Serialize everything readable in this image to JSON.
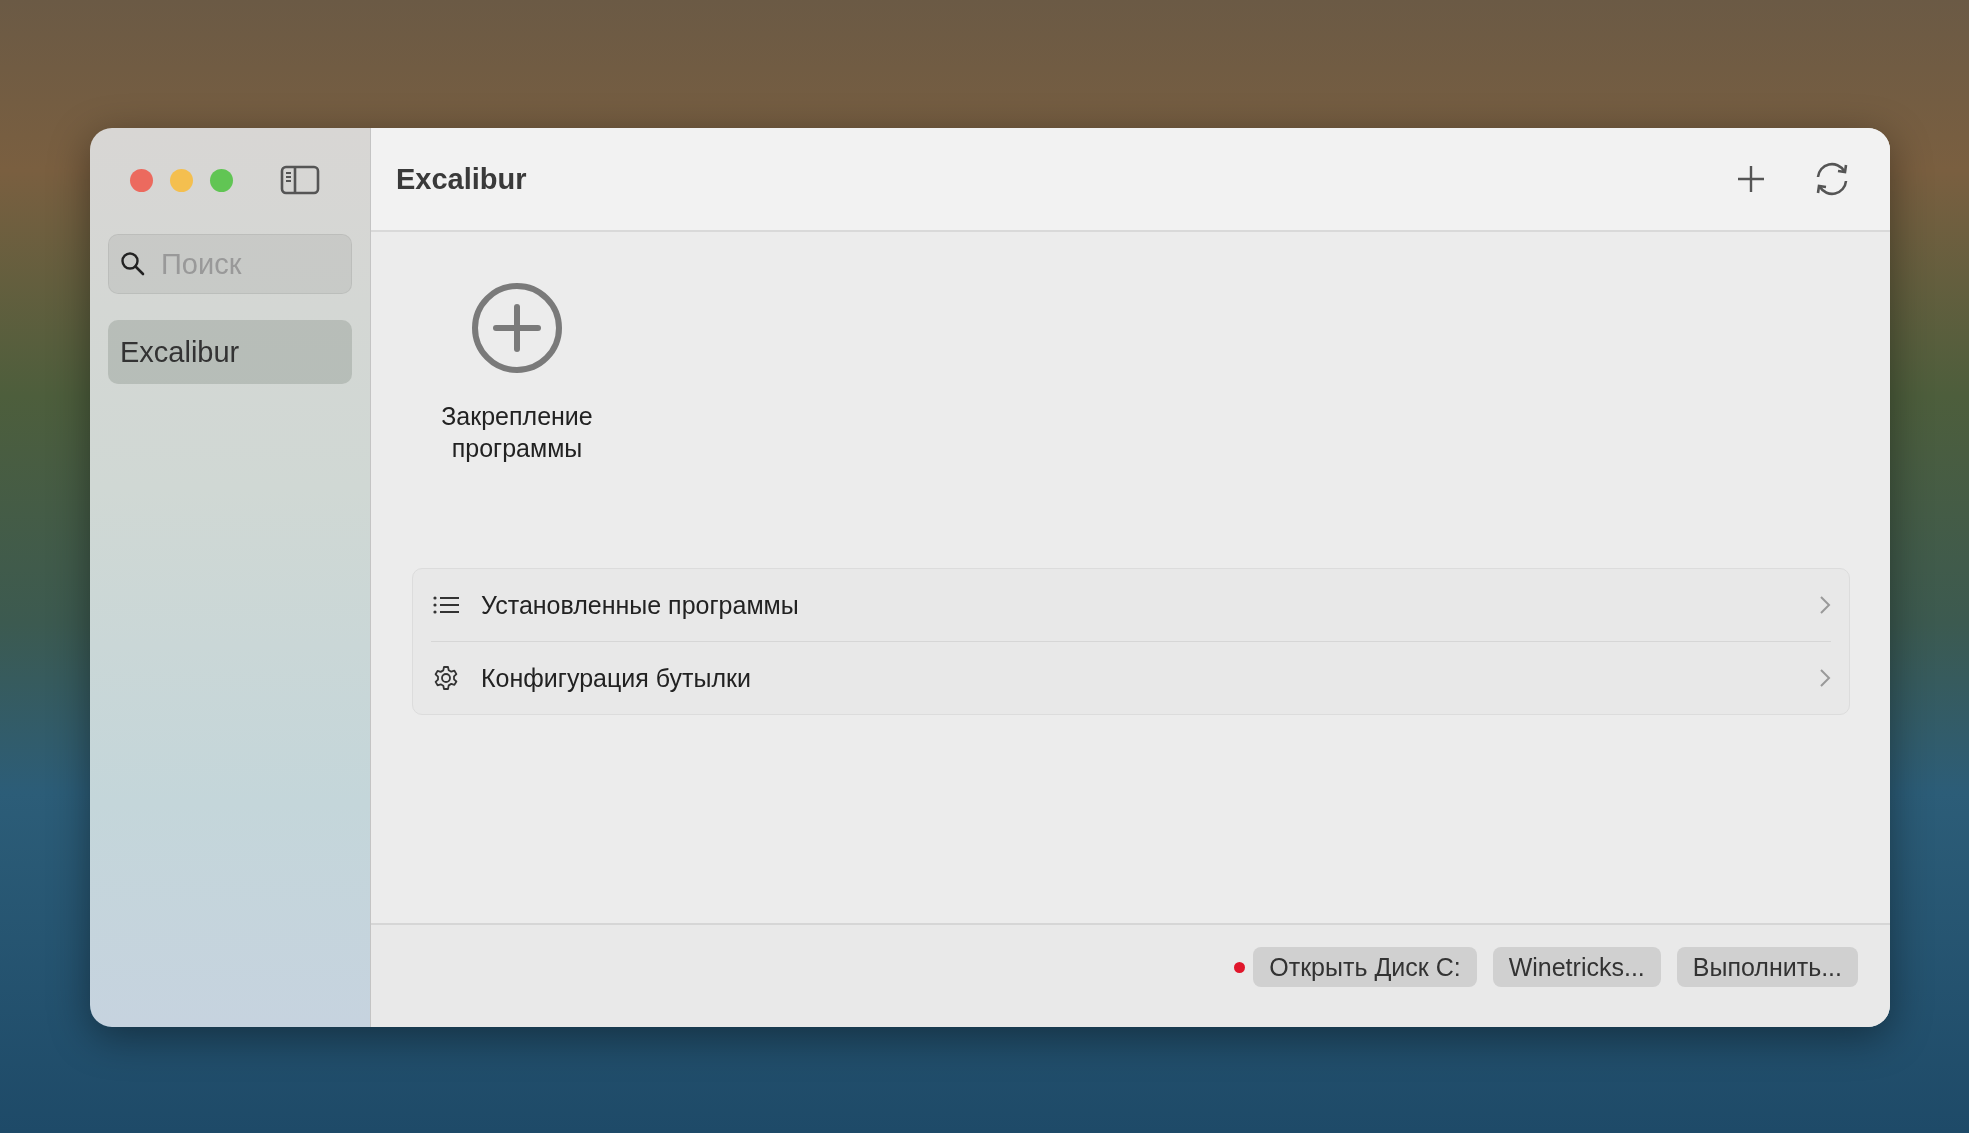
{
  "sidebar": {
    "search": {
      "placeholder": "Поиск"
    },
    "items": [
      {
        "label": "Excalibur",
        "selected": true
      }
    ]
  },
  "header": {
    "title": "Excalibur"
  },
  "pin_tile": {
    "label": "Закрепление программы"
  },
  "menu_rows": [
    {
      "kind": "list",
      "label": "Установленные программы"
    },
    {
      "kind": "settings",
      "label": "Конфигурация бутылки"
    }
  ],
  "footer": {
    "indicator_on": true,
    "buttons": [
      "Открыть Диск C:",
      "Winetricks...",
      "Выполнить..."
    ]
  }
}
